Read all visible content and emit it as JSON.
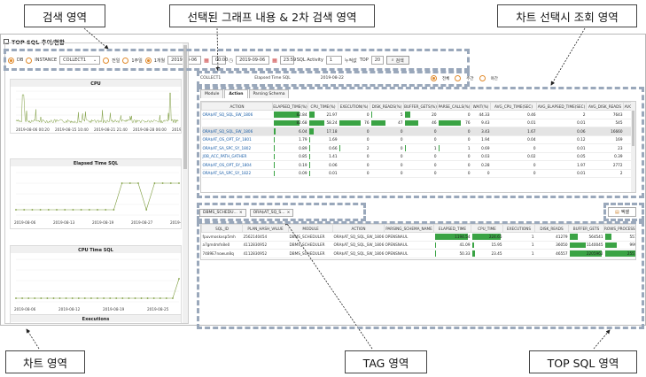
{
  "callouts": {
    "search_area": "검색 영역",
    "selected_graph": "선택된 그래프 내용 & 2차 검색 영역",
    "chart_select": "차트 선택시 조회 영역",
    "chart_area": "차트 영역",
    "tag_area": "TAG 영역",
    "topsql_area": "TOP SQL 영역"
  },
  "window": {
    "title": "TOP SQL 추이/현황"
  },
  "search": {
    "db_label": "DB",
    "instance_label": "INSTANCE",
    "instance_value": "COLLECT1",
    "period_options": [
      "전일",
      "1주일",
      "1개월"
    ],
    "period_selected": "1개월",
    "start_date": "2019-08-06",
    "start_time": "00:00",
    "end_date": "2019-09-06",
    "end_time": "23:59",
    "sql_activity_label": "SQL Activity",
    "sql_activity_value": "1",
    "accum_label": "누적값",
    "top_label": "TOP",
    "top_value": "20",
    "search_button": "검색"
  },
  "charts": [
    {
      "title": "CPU",
      "x_ticks": [
        "2019-08-06 00:20",
        "2019-08-15 10:40",
        "2019-08-21 21:40",
        "2019-08-28 06:00",
        "2019-09-04 19:40"
      ]
    },
    {
      "title": "Elapsed Time SQL",
      "x_ticks": [
        "2019-08-06",
        "2019-08-13",
        "2019-08-19",
        "2019-08-27",
        "2019-09-03"
      ]
    },
    {
      "title": "CPU Time SQL",
      "x_ticks": [
        "2019-08-06",
        "2019-08-12",
        "2019-08-19",
        "2019-08-25"
      ]
    },
    {
      "title": "Executions"
    }
  ],
  "selected_info": {
    "instance": "COLLECT1",
    "metric": "Elapsed Time SQL",
    "date": "2019-08-22"
  },
  "secondary_radios": {
    "options": [
      "전체",
      "주간",
      "야간"
    ],
    "selected": "전체"
  },
  "tabs": [
    "Module",
    "Action",
    "Parsing Schema"
  ],
  "active_tab": "Action",
  "grid1": {
    "columns": [
      "ACTION",
      "ELAPSED_TIME(%)",
      "CPU_TIME(%)",
      "EXECUTION(%)",
      "DISK_READS(%)",
      "BUFFER_GETS(%)",
      "PARSE_CALLS(%)",
      "WAIT(%)",
      "AVG_CPU_TIME(SEC)",
      "AVG_ELAPSED_TIME(SEC)",
      "AVG_DISK_READS",
      "AVG_B"
    ],
    "rows": [
      [
        "ORA$AT_SQ_SQL_SW_1806",
        "82.84",
        "21.97",
        "0",
        "5",
        "20",
        "0",
        "44.33",
        "0.46",
        "2",
        "7643",
        ""
      ],
      [
        "",
        "82.68",
        "58.24",
        "76",
        "47",
        "46",
        "76",
        "9.43",
        "0.01",
        "0.01",
        "545",
        ""
      ],
      [
        "ORA$AT_SQ_SQL_SW_1806",
        "6.04",
        "17.18",
        "0",
        "0",
        "0",
        "0",
        "3.43",
        "1.67",
        "0.06",
        "16660",
        ""
      ],
      [
        "ORA$AT_OS_OPT_SY_1801",
        "1.79",
        "1.69",
        "0",
        "0",
        "0",
        "0",
        "1.94",
        "0.04",
        "0.12",
        "169",
        ""
      ],
      [
        "ORA$AT_SA_SPC_SY_1802",
        "0.89",
        "0.66",
        "2",
        "0",
        "1",
        "1",
        "0.69",
        "0",
        "0.01",
        "23",
        ""
      ],
      [
        "JOB_ACC_PATH_GATHER",
        "0.85",
        "1.41",
        "0",
        "0",
        "0",
        "0",
        "0.03",
        "0.02",
        "0.05",
        "0.39",
        ""
      ],
      [
        "ORA$AT_OS_OPT_SY_1804",
        "0.19",
        "0.06",
        "0",
        "0",
        "0",
        "0",
        "0.28",
        "0",
        "1.97",
        "2772",
        ""
      ],
      [
        "ORA$AT_SA_SPC_SY_1822",
        "0.09",
        "0.01",
        "0",
        "0",
        "0",
        "0",
        "0",
        "0",
        "0.01",
        "2",
        ""
      ]
    ],
    "highlight_row": 2
  },
  "tags": [
    "DBMS_SCHEDU...",
    "ORA$AT_SQ_S..."
  ],
  "excel_button": "엑셀",
  "grid2": {
    "columns": [
      "SQL_ID",
      "PLAN_HASH_VALUE",
      "MODULE",
      "ACTION",
      "PARSING_SCHEMA_NAME",
      "ELAPSED_TIME",
      "CPU_TIME",
      "EXECUTIONS",
      "DISK_READS",
      "BUFFER_GETS",
      "ROWS_PROCESSED"
    ],
    "rows": [
      [
        "fpuvmoskxsp5mh",
        "2562140454",
        "DBMS_SCHEDULER",
        "ORA$AT_SQ_SQL_SW_1806",
        "OPENSNAUL",
        "1194.54",
        "224.65",
        "1",
        "41279",
        "564541",
        "557"
      ],
      [
        "a7gmdmfn8e0",
        "4112830952",
        "DBMS_SCHEDULER",
        "ORA$AT_SQ_SQL_SW_1806",
        "OPENSNAUL",
        "41.09",
        "15.95",
        "1",
        "36050",
        "1140045",
        "999"
      ],
      [
        "7489E7nowun8q",
        "4112830952",
        "DBMS_SCHEDULER",
        "ORA$AT_SQ_SQL_SW_1806",
        "OPENSNAUL",
        "50.33",
        "23.45",
        "1",
        "46557",
        "2205962",
        "2557"
      ]
    ]
  },
  "colors": {
    "bar_green": "#3aa344",
    "radio_orange": "#e08a2c",
    "line_green": "#7a9a3a",
    "dash_border": "#9aa8bb"
  }
}
